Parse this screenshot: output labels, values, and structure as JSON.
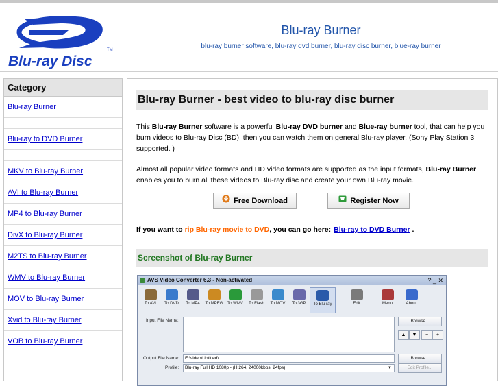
{
  "header": {
    "title": "Blu-ray Burner",
    "tagline": "blu-ray burner software, blu-ray dvd burner, blu-ray disc burner, blue-ray burner",
    "logo_text": "Blu-ray Disc"
  },
  "sidebar": {
    "heading": "Category",
    "items": [
      {
        "label": "Blu-ray Burner"
      },
      {
        "label": ""
      },
      {
        "label": "Blu-ray to DVD Burner"
      },
      {
        "label": ""
      },
      {
        "label": "MKV to Blu-ray Burner"
      },
      {
        "label": "AVI to Blu-ray Burner"
      },
      {
        "label": "MP4 to Blu-ray Burner"
      },
      {
        "label": "DivX to Blu-ray Burner"
      },
      {
        "label": "M2TS to Blu-ray Burner"
      },
      {
        "label": "WMV to Blu-ray Burner"
      },
      {
        "label": "MOV to Blu-ray Burner"
      },
      {
        "label": "Xvid to Blu-ray Burner"
      },
      {
        "label": "VOB to Blu-ray Burner"
      },
      {
        "label": ""
      }
    ]
  },
  "main": {
    "title": "Blu-ray Burner - best video to blu-ray disc burner",
    "p1": {
      "t1": "This ",
      "b1": "Blu-ray Burner",
      "t2": " software is a powerful ",
      "b2": "Blu-ray DVD burner",
      "t3": " and ",
      "b3": "Blue-ray burner",
      "t4": " tool, that can help you burn videos to Blu-ray Disc (BD), then you can watch them on general Blu-ray player. (Sony Play Station 3 supported. )"
    },
    "p2": {
      "t1": "Almost all popular video formats and HD video formats are supported as the input formats, ",
      "b1": "Blu-ray Burner",
      "t2": " enables you to burn all these videos to Blu-ray disc and create your own Blu-ray movie."
    },
    "download_label": "Free Download",
    "register_label": "Register Now",
    "rip": {
      "t1": "If you want to ",
      "orange": "rip Blu-ray movie to DVD",
      "t2": ", you can go here:",
      "link": "Blu-ray to DVD Burner",
      "t3": " ."
    },
    "screenshot_heading": "Screenshot of Blu-ray Burner"
  },
  "app": {
    "title": "AVS Video Converter 6.3 - Non-activated",
    "window_controls": "? _ ✕",
    "tools": [
      "To AVI",
      "To DVD",
      "To MP4",
      "To MPEG",
      "To WMV",
      "To Flash",
      "To MOV",
      "To 3GP",
      "To Blu-ray",
      "Edit",
      "Menu",
      "About"
    ],
    "tool_colors": [
      "#8a6a3a",
      "#3a7acc",
      "#555a8a",
      "#cc8a22",
      "#2a9a3a",
      "#999999",
      "#3a8acc",
      "#6a6aaa",
      "#2a5aaa",
      "#7a7a7a",
      "#aa3a3a",
      "#3a6acc"
    ],
    "input_label": "Input File Name:",
    "browse_label": "Browse...",
    "arrow_up": "▲",
    "arrow_down": "▼",
    "minus": "−",
    "plus": "+",
    "output_label": "Output File Name:",
    "output_value": "E:\\video\\Untitled\\",
    "profile_label": "Profile:",
    "profile_value": "Blu-ray Full HD 1080p - (H.264, 24000kbps, 24fps)",
    "edit_profile_label": "Edit Profile..."
  },
  "colors": {
    "link": "#0000cc",
    "title_blue": "#2255aa",
    "orange": "#ff6600",
    "green_heading": "#227722"
  }
}
